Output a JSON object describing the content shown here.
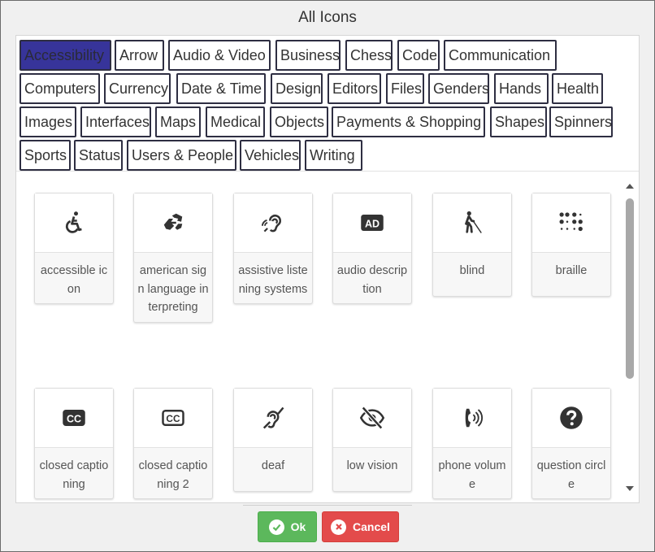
{
  "dialog": {
    "title": "All Icons"
  },
  "categories": [
    "Accessibility",
    "Arrow",
    "Audio & Video",
    "Business",
    "Chess",
    "Code",
    "Communication",
    "Computers",
    "Currency",
    "Date & Time",
    "Design",
    "Editors",
    "Files",
    "Genders",
    "Hands",
    "Health",
    "Images",
    "Interfaces",
    "Maps",
    "Medical",
    "Objects",
    "Payments & Shopping",
    "Shapes",
    "Spinners",
    "Sports",
    "Status",
    "Users & People",
    "Vehicles",
    "Writing"
  ],
  "selected_category": "Accessibility",
  "icons": [
    {
      "label": "accessible icon",
      "icon": "wheelchair-icon"
    },
    {
      "label": "american sign language interpreting",
      "icon": "sign-language-icon"
    },
    {
      "label": "assistive listening systems",
      "icon": "assistive-listening-icon"
    },
    {
      "label": "audio description",
      "icon": "audio-description-icon"
    },
    {
      "label": "blind",
      "icon": "blind-person-icon"
    },
    {
      "label": "braille",
      "icon": "braille-icon"
    },
    {
      "label": "closed captioning",
      "icon": "closed-captioning-icon"
    },
    {
      "label": "closed captioning 2",
      "icon": "closed-captioning-outline-icon"
    },
    {
      "label": "deaf",
      "icon": "deaf-icon"
    },
    {
      "label": "low vision",
      "icon": "low-vision-icon"
    },
    {
      "label": "phone volume",
      "icon": "phone-volume-icon"
    },
    {
      "label": "question circle",
      "icon": "question-circle-icon"
    }
  ],
  "buttons": {
    "ok": "Ok",
    "cancel": "Cancel"
  },
  "colors": {
    "selected_category": "#37349a",
    "ok": "#5cb85c",
    "cancel": "#e34b4b"
  }
}
